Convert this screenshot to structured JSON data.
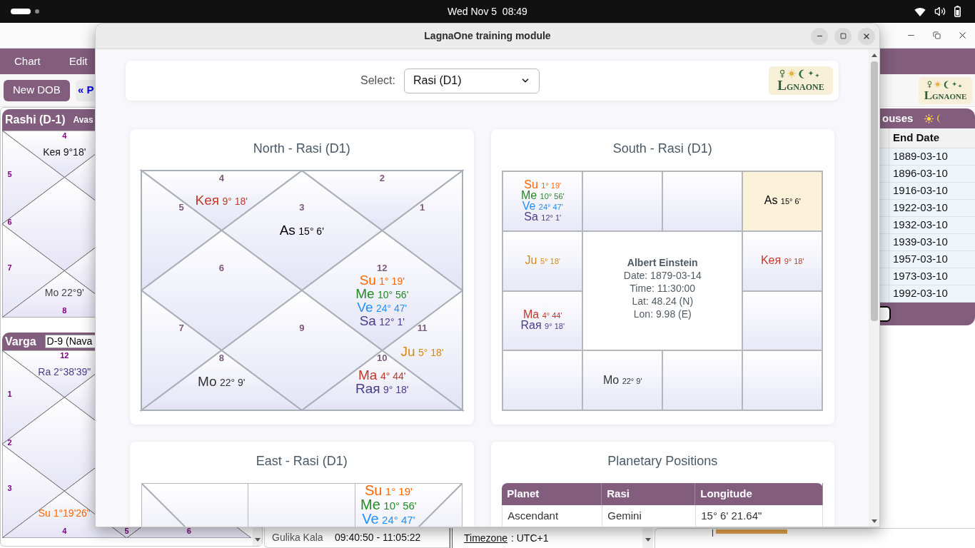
{
  "top_bar": {
    "clock": "Wed Nov 5  08:49"
  },
  "app_window": {
    "menu": [
      {
        "label": "Chart"
      },
      {
        "label": "Edit"
      }
    ],
    "toolbar": [
      {
        "label": "New DOB",
        "kind": "primary"
      },
      {
        "label": "« P",
        "kind": "nav"
      }
    ],
    "logo": {
      "initial": "L",
      "rest": "GNAONE"
    },
    "rashi_panel": {
      "title": "Rashi (D-1)",
      "tab": "Avas",
      "houses": [
        {
          "sign": "4",
          "text": "Keя 9°18'",
          "color": "#111111"
        },
        {
          "sign": "5"
        },
        {
          "sign": "6"
        },
        {
          "sign": "7"
        },
        {
          "sign": "8",
          "text": "Mo 22°9'",
          "color": "#444444"
        }
      ]
    },
    "varga_panel": {
      "title": "Varga",
      "division": "D-9 (Nava",
      "houses": [
        {
          "sign": "12",
          "text": "Ra 2°38'39\"",
          "color": "#483d8b"
        },
        {
          "sign": "1"
        },
        {
          "sign": "2"
        },
        {
          "sign": "3"
        },
        {
          "sign": "4",
          "text": "Su 1°19'26\"",
          "color": "#ff6600"
        },
        {
          "sign": "5"
        },
        {
          "sign": "6"
        }
      ]
    },
    "timing": {
      "label": "Gulika Kala",
      "value": "09:40:50 - 11:05:22"
    },
    "timezone": {
      "label": "Timezone",
      "value": ": UTC+1"
    },
    "dasha_panel": {
      "title": "ouses",
      "column": "End Date",
      "rows": [
        "1889-03-10",
        "1896-03-10",
        "1916-03-10",
        "1922-03-10",
        "1932-03-10",
        "1939-03-10",
        "1957-03-10",
        "1973-03-10",
        "1992-03-10"
      ]
    }
  },
  "dialog": {
    "title": "LagnaOne training module",
    "select": {
      "label": "Select:",
      "value": "Rasi (D1)"
    },
    "logo": {
      "initial": "L",
      "rest": "GNAONE"
    },
    "north_chart": {
      "title": "North - Rasi (D1)",
      "houses": [
        {
          "sign": "3",
          "planets": [
            {
              "abbr": "As",
              "deg": "15° 6'",
              "color": "#000000"
            }
          ]
        },
        {
          "sign": "4",
          "planets": [
            {
              "abbr": "Keя",
              "deg": "9° 18'",
              "color": "#c0392b"
            }
          ]
        },
        {
          "sign": "5"
        },
        {
          "sign": "6"
        },
        {
          "sign": "7"
        },
        {
          "sign": "8",
          "planets": [
            {
              "abbr": "Mo",
              "deg": "22° 9'",
              "color": "#333333"
            }
          ]
        },
        {
          "sign": "9"
        },
        {
          "sign": "10",
          "planets": [
            {
              "abbr": "Ma",
              "deg": "4° 44'",
              "color": "#c0392b"
            },
            {
              "abbr": "Raя",
              "deg": "9° 18'",
              "color": "#483d8b"
            }
          ]
        },
        {
          "sign": "11",
          "planets": [
            {
              "abbr": "Ju",
              "deg": "5° 18'",
              "color": "#d68910"
            }
          ]
        },
        {
          "sign": "12",
          "planets": [
            {
              "abbr": "Su",
              "deg": "1° 19'",
              "color": "#ff6600"
            },
            {
              "abbr": "Me",
              "deg": "10° 56'",
              "color": "#228b22"
            },
            {
              "abbr": "Ve",
              "deg": "24° 47'",
              "color": "#1e90ff"
            },
            {
              "abbr": "Sa",
              "deg": "12° 1'",
              "color": "#483d8b"
            }
          ]
        },
        {
          "sign": "1"
        },
        {
          "sign": "2"
        }
      ]
    },
    "south_chart": {
      "title": "South - Rasi (D1)",
      "cells": [
        {
          "highlighted": false,
          "planets": [
            {
              "abbr": "Su",
              "deg": "1° 19'",
              "color": "#ff6600"
            },
            {
              "abbr": "Me",
              "deg": "10° 56'",
              "color": "#228b22"
            },
            {
              "abbr": "Ve",
              "deg": "24° 47'",
              "color": "#1e90ff"
            },
            {
              "abbr": "Sa",
              "deg": "12° 1'",
              "color": "#483d8b"
            }
          ]
        },
        {
          "highlighted": false
        },
        {
          "highlighted": false
        },
        {
          "highlighted": true,
          "planets": [
            {
              "abbr": "As",
              "deg": "15° 6'",
              "color": "#000000"
            }
          ]
        },
        {
          "highlighted": false,
          "planets": [
            {
              "abbr": "Ju",
              "deg": "5° 18'",
              "color": "#d68910"
            }
          ]
        },
        {
          "highlighted": false,
          "planets": [
            {
              "abbr": "Keя",
              "deg": "9° 18'",
              "color": "#c0392b"
            }
          ]
        },
        {
          "highlighted": false,
          "planets": [
            {
              "abbr": "Ma",
              "deg": "4° 44'",
              "color": "#c0392b"
            },
            {
              "abbr": "Raя",
              "deg": "9° 18'",
              "color": "#483d8b"
            }
          ]
        },
        {
          "highlighted": false
        },
        {
          "highlighted": false
        },
        {
          "highlighted": false,
          "planets": [
            {
              "abbr": "Mo",
              "deg": "22° 9'",
              "color": "#333333"
            }
          ]
        },
        {
          "highlighted": false
        },
        {
          "highlighted": false
        }
      ],
      "center": {
        "name": "Albert Einstein",
        "lines": [
          "Date: 1879-03-14",
          "Time: 11:30:00",
          "Lat: 48.24 (N)",
          "Lon: 9.98 (E)"
        ]
      }
    },
    "east_chart": {
      "title": "East - Rasi (D1)",
      "cells": [
        {
          "kind": "corner"
        },
        {
          "kind": "plain"
        },
        {
          "kind": "corner",
          "planets": [
            {
              "abbr": "Su",
              "deg": "1° 19'",
              "color": "#ff6600"
            },
            {
              "abbr": "Me",
              "deg": "10° 56'",
              "color": "#228b22"
            },
            {
              "abbr": "Ve",
              "deg": "24° 47'",
              "color": "#1e90ff"
            }
          ]
        }
      ]
    },
    "positions_table": {
      "title": "Planetary Positions",
      "columns": [
        "Planet",
        "Rasi",
        "Longitude"
      ],
      "rows": [
        [
          "Ascendant",
          "Gemini",
          "15° 6' 21.64\""
        ]
      ]
    }
  }
}
